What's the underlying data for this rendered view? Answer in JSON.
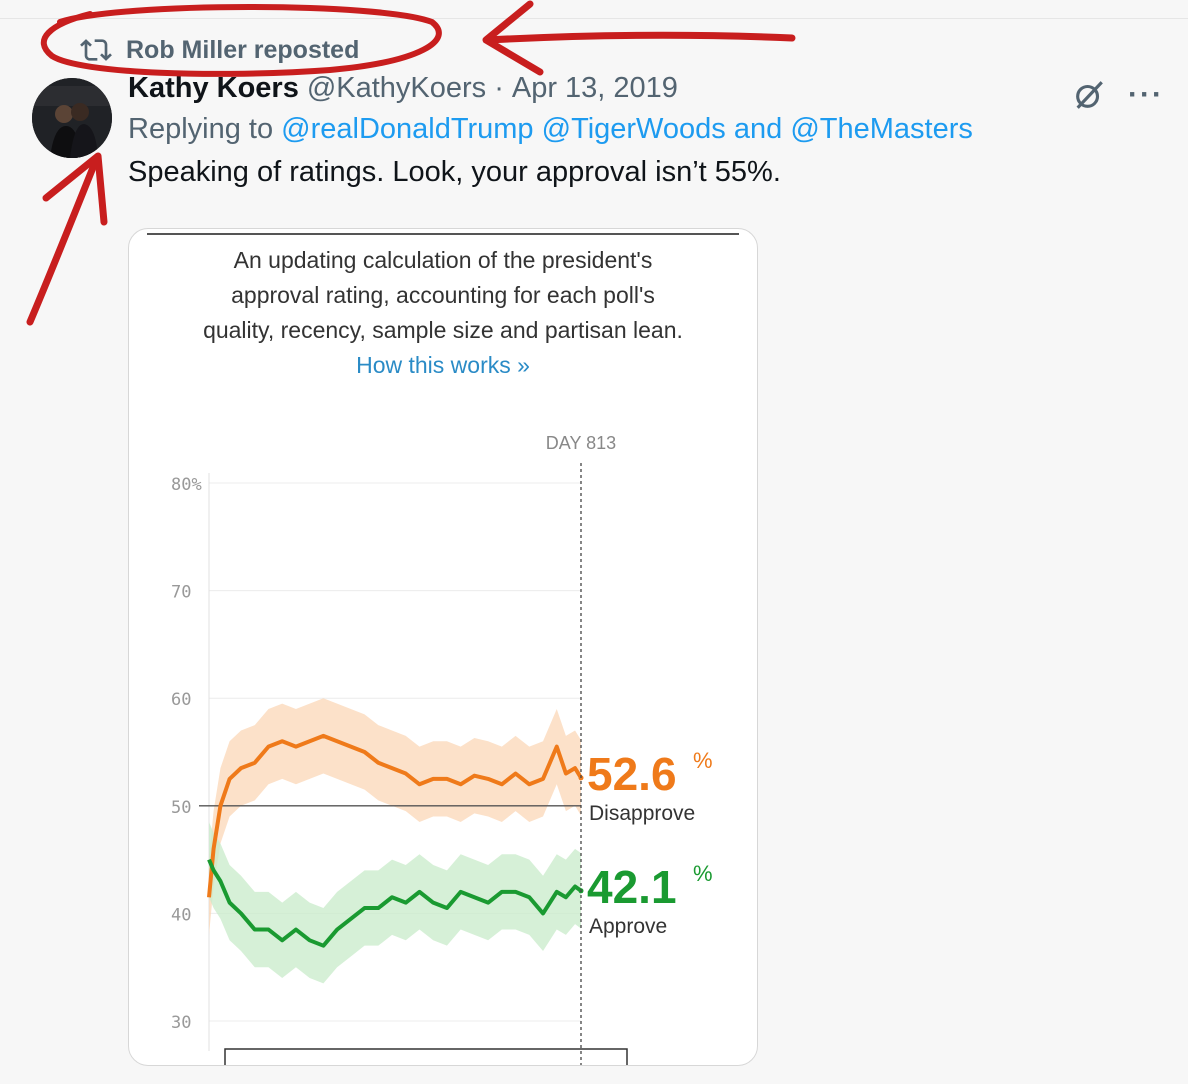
{
  "repost": {
    "label": "Rob Miller reposted",
    "icon": "repost-icon"
  },
  "tweet": {
    "author_name": "Kathy Koers",
    "author_handle": "@KathyKoers",
    "separator": "·",
    "date": "Apr 13, 2019",
    "replying_prefix": "Replying to",
    "mentions": [
      "@realDonaldTrump",
      "@TigerWoods",
      "@TheMasters"
    ],
    "mention_joiner_and": "and",
    "text": "Speaking of ratings. Look, your approval isn’t 55%.",
    "more_label": "···"
  },
  "card": {
    "subtitle_lines": [
      "An updating calculation of the president's",
      "approval rating, accounting for each poll's",
      "quality, recency, sample size and partisan lean."
    ],
    "how_link": "How this works »"
  },
  "chart_data": {
    "type": "line",
    "title": "An updating calculation of the president's approval rating, accounting for each poll's quality, recency, sample size and partisan lean.",
    "marker_label": "DAY 813",
    "marker_day": 813,
    "y_ticks": [
      "80%",
      "70",
      "60",
      "50",
      "40",
      "30"
    ],
    "y_tick_values": [
      80,
      70,
      60,
      50,
      40,
      30
    ],
    "ylim": [
      30,
      80
    ],
    "xlim": [
      0,
      813
    ],
    "grid": true,
    "series": [
      {
        "name": "Disapprove",
        "final_value": "52.6",
        "unit": "%",
        "color": "#ef7a1a",
        "band_color": "#fbd7b7",
        "x": [
          0,
          10,
          25,
          45,
          70,
          100,
          130,
          160,
          190,
          220,
          250,
          280,
          310,
          340,
          370,
          400,
          430,
          460,
          490,
          520,
          550,
          580,
          610,
          640,
          670,
          700,
          730,
          760,
          780,
          800,
          813
        ],
        "values": [
          41.5,
          46,
          50,
          52.5,
          53.5,
          54,
          55.5,
          56,
          55.5,
          56,
          56.5,
          56,
          55.5,
          55,
          54,
          53.5,
          53,
          52,
          52.5,
          52.5,
          52,
          52.8,
          52.5,
          52,
          53,
          52,
          52.5,
          55.5,
          53,
          53.5,
          52.6
        ]
      },
      {
        "name": "Approve",
        "final_value": "42.1",
        "unit": "%",
        "color": "#1a9a31",
        "band_color": "#c8ebc9",
        "x": [
          0,
          10,
          25,
          45,
          70,
          100,
          130,
          160,
          190,
          220,
          250,
          280,
          310,
          340,
          370,
          400,
          430,
          460,
          490,
          520,
          550,
          580,
          610,
          640,
          670,
          700,
          730,
          760,
          780,
          800,
          813
        ],
        "values": [
          45,
          44,
          43,
          41,
          40,
          38.5,
          38.5,
          37.5,
          38.5,
          37.5,
          37,
          38.5,
          39.5,
          40.5,
          40.5,
          41.5,
          41,
          42,
          41,
          40.5,
          42,
          41.5,
          41,
          42,
          42,
          41.5,
          40,
          42,
          41.5,
          42.5,
          42.1
        ]
      }
    ],
    "reference_line": 50
  }
}
